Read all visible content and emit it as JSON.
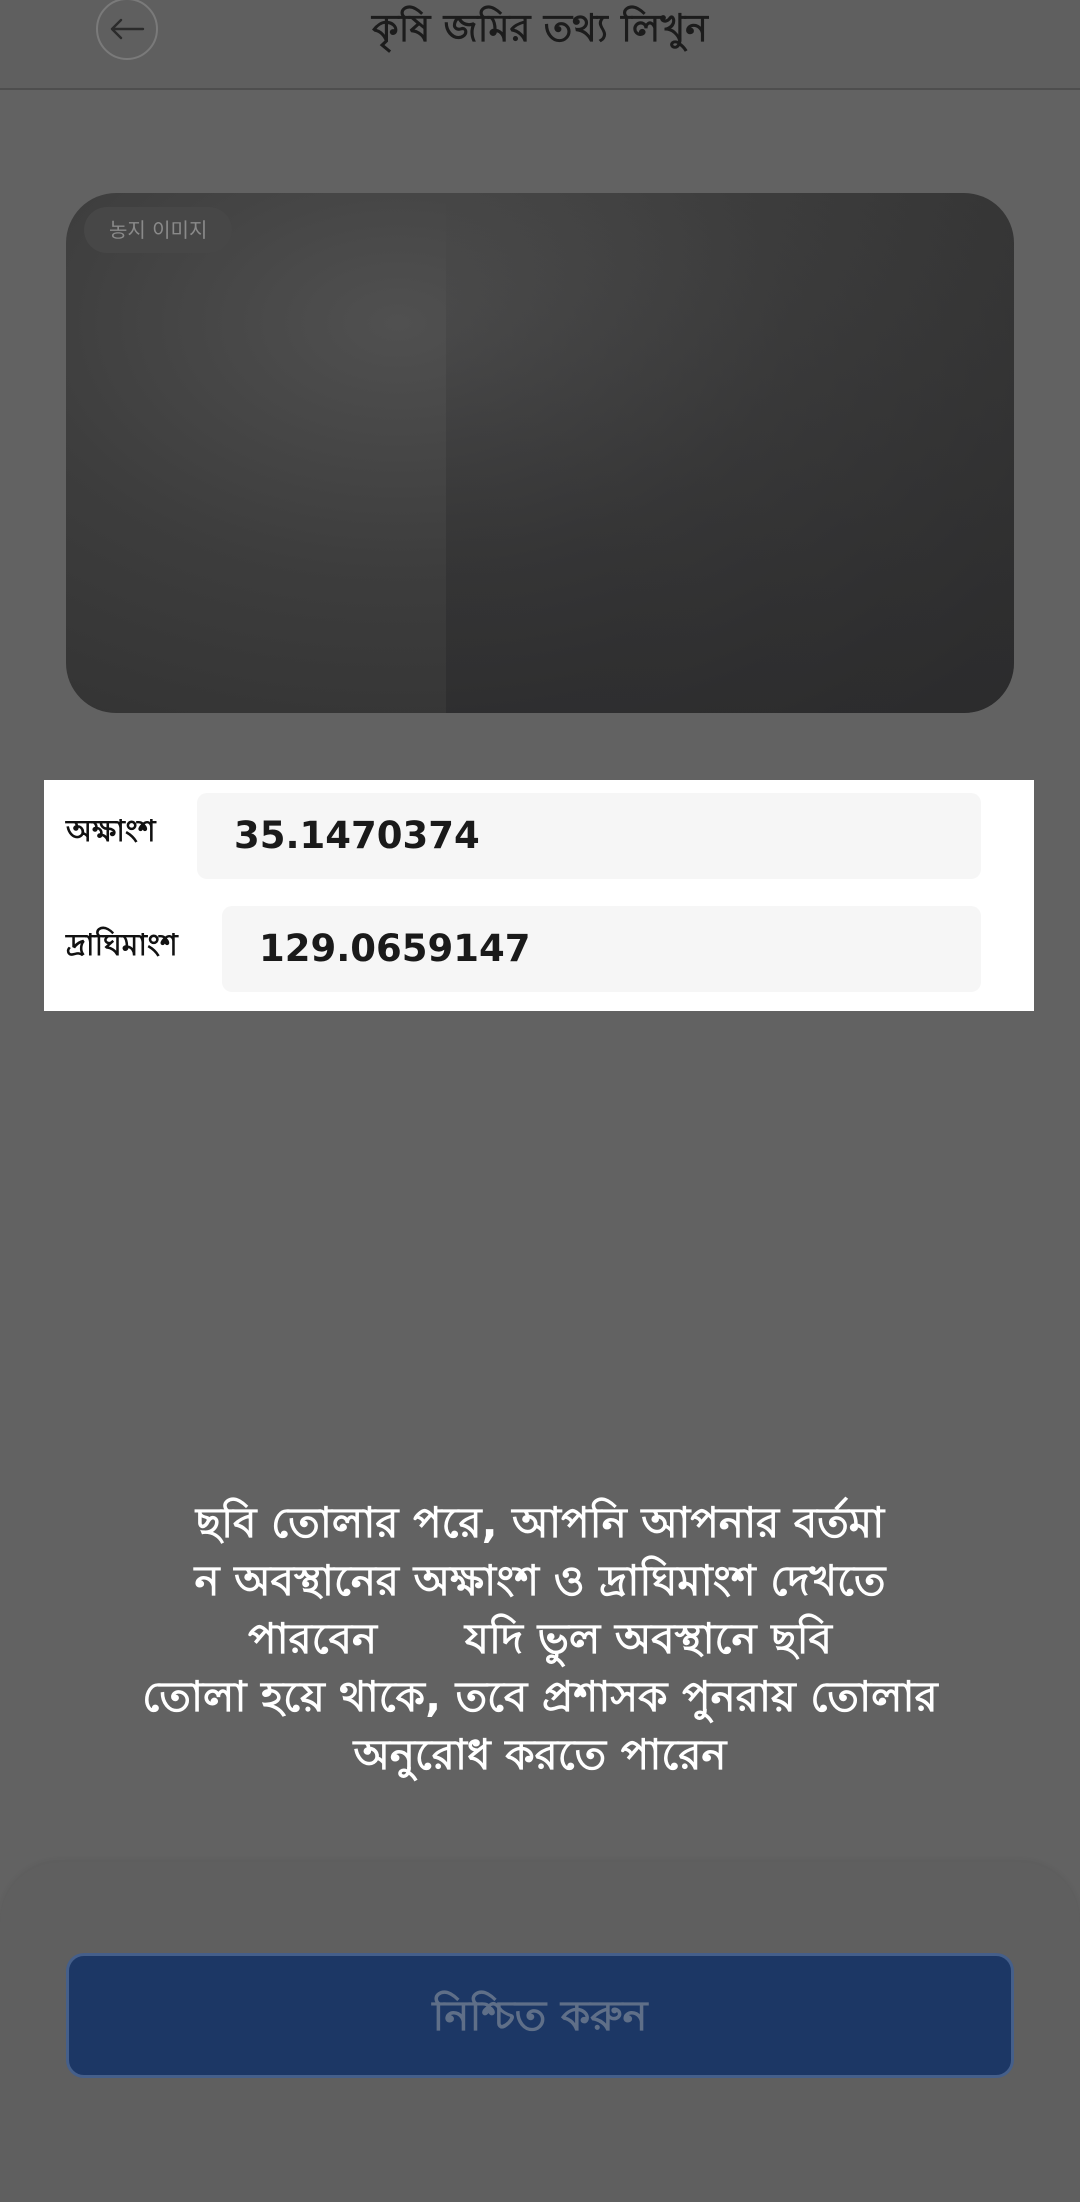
{
  "header": {
    "back_icon": "arrow-left-icon",
    "title": "কৃষি জমির তথ্য লিখুন"
  },
  "photo": {
    "badge": "농지 이미지"
  },
  "coordinates": {
    "latitude_label": "অক্ষাংশ",
    "latitude_value": "35.1470374",
    "longitude_label": "দ্রাঘিমাংশ",
    "longitude_value": "129.0659147"
  },
  "info": {
    "lines": [
      "ছবি তোলার পরে, আপনি আপনার বর্তমা",
      "ন অবস্থানের অক্ষাংশ ও দ্রাঘিমাংশ দেখতে",
      "পারবেন      যদি ভুল অবস্থানে ছবি",
      "তোলা হয়ে থাকে, তবে প্রশাসক পুনরায় তোলার",
      "অনুরোধ করতে পারেন"
    ]
  },
  "footer": {
    "confirm_label": "নিশ্চিত করুন"
  },
  "colors": {
    "overlay_background": "#626262",
    "confirm_button": "#1c3765",
    "panel": "#ffffff"
  }
}
